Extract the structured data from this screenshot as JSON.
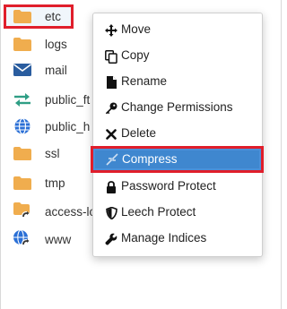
{
  "files": [
    {
      "name": "etc",
      "icon": "folder-icon"
    },
    {
      "name": "logs",
      "icon": "folder-icon"
    },
    {
      "name": "mail",
      "icon": "envelope-icon"
    },
    {
      "name": "public_ft",
      "icon": "exchange-arrows-icon"
    },
    {
      "name": "public_h",
      "icon": "globe-icon"
    },
    {
      "name": "ssl",
      "icon": "folder-icon"
    },
    {
      "name": "tmp",
      "icon": "folder-icon"
    },
    {
      "name": "access-lo",
      "icon": "folder-link-icon"
    },
    {
      "name": "www",
      "icon": "globe-link-icon"
    }
  ],
  "context_menu": {
    "items": [
      {
        "label": "Move",
        "icon": "move-arrows-icon"
      },
      {
        "label": "Copy",
        "icon": "copy-icon"
      },
      {
        "label": "Rename",
        "icon": "file-icon"
      },
      {
        "label": "Change Permissions",
        "icon": "key-icon"
      },
      {
        "label": "Delete",
        "icon": "x-icon"
      },
      {
        "label": "Compress",
        "icon": "compress-icon",
        "state": "highlighted"
      },
      {
        "label": "Password Protect",
        "icon": "lock-icon"
      },
      {
        "label": "Leech Protect",
        "icon": "shield-icon"
      },
      {
        "label": "Manage Indices",
        "icon": "wrench-icon"
      }
    ]
  },
  "colors": {
    "folder": "#f0ad4e",
    "mail": "#2a5d9f",
    "transfer": "#2f9e85",
    "globe": "#2a6fd6",
    "highlight_border": "#e01e2b",
    "menu_highlight": "#3f87cf"
  }
}
